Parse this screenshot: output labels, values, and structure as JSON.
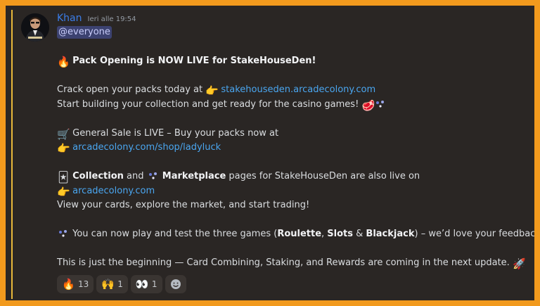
{
  "message": {
    "author": "Khan",
    "timestamp": "Ieri alle 19:54",
    "mention": "@everyone",
    "lines": {
      "l1_title": "Pack Opening is NOW LIVE for StakeHouseDen!",
      "l2_text": "Crack open your packs today at ",
      "l2_link": "stakehouseden.arcadecolony.com",
      "l3_text": "Start building your collection and get ready for the casino games! ",
      "l4_text": " General Sale is LIVE – Buy your packs now at",
      "l5_link": "arcadecolony.com/shop/ladyluck",
      "l6_bold1": "Collection",
      "l6_and": " and ",
      "l6_bold2": "Marketplace",
      "l6_rest": " pages for StakeHouseDen are also live on",
      "l7_link": "arcadecolony.com",
      "l8_text": "View your cards, explore the market, and start trading!",
      "l9_pre": " You can now play and test the three games (",
      "l9_b1": "Roulette",
      "l9_comma": ", ",
      "l9_b2": "Slots",
      "l9_amp": " & ",
      "l9_b3": "Blackjack",
      "l9_post": ")  – we’d love your feedback!",
      "l10_text": "This is just the beginning — Card Combining, Staking, and Rewards are coming in the next update. "
    }
  },
  "emojis": {
    "fire": "🔥",
    "point_right": "👉",
    "steak": "🥩",
    "cart": "🛒",
    "cards": "🃏",
    "eyes": "👀",
    "raised_hands": "🙌",
    "rocket": "🚀"
  },
  "reactions": [
    {
      "emoji": "🔥",
      "count": "13"
    },
    {
      "emoji": "🙌",
      "count": "1"
    },
    {
      "emoji": "👀",
      "count": "1"
    }
  ],
  "colors": {
    "frame_border": "#f29a1d",
    "background": "#2a2624",
    "username": "#3b7de8",
    "link": "#4aa6f0",
    "mention_bar": "#e8b83a"
  }
}
